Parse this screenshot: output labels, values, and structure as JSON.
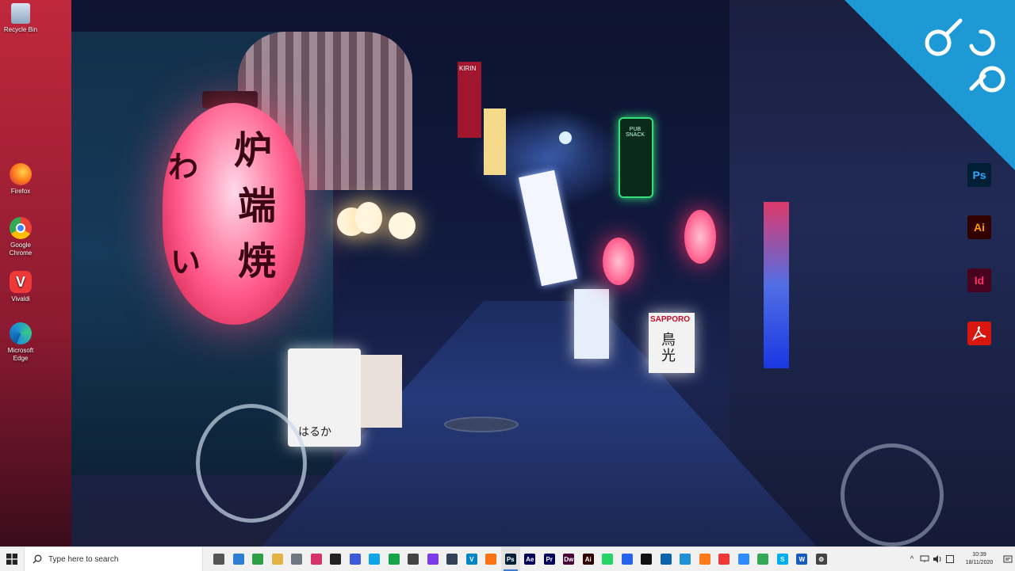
{
  "desktop": {
    "icons": [
      {
        "label": "Recycle Bin",
        "icon": "recycle-bin-icon"
      },
      {
        "label": "Firefox",
        "icon": "firefox-icon",
        "color": "#ff7a1a"
      },
      {
        "label": "Google Chrome",
        "icon": "chrome-icon",
        "color": "#34a853"
      },
      {
        "label": "Vivaldi",
        "icon": "vivaldi-icon",
        "color": "#ef3939"
      },
      {
        "label": "Microsoft Edge",
        "icon": "edge-icon",
        "color": "#1f8fd6"
      }
    ],
    "side_apps": [
      {
        "label": "Ps",
        "icon": "photoshop-icon",
        "bg": "#001e36",
        "fg": "#31a8ff"
      },
      {
        "label": "Ai",
        "icon": "illustrator-icon",
        "bg": "#330000",
        "fg": "#ff9a00"
      },
      {
        "label": "Id",
        "icon": "indesign-icon",
        "bg": "#49021f",
        "fg": "#ff3366"
      },
      {
        "label": "",
        "icon": "acrobat-icon",
        "bg": "#d8180f",
        "fg": "#ffffff"
      }
    ]
  },
  "wallpaper": {
    "description_icon": "neon-alley-wallpaper",
    "lantern_glyphs": [
      "炉",
      "端",
      "焼"
    ],
    "lantern_side_glyphs": [
      "わ",
      "い"
    ],
    "signs": {
      "pub_snack": "PUB SNACK",
      "sapporo": "SAPPORO",
      "sapporo_sub": "鳥光",
      "haruka": "はるか",
      "kirin": "KIRIN"
    }
  },
  "corner_logo": {
    "icon": "dcp-logo",
    "color": "#1d9ad6"
  },
  "taskbar": {
    "search_placeholder": "Type here to search",
    "apps": [
      {
        "icon": "task-view-icon",
        "glyph": "",
        "color": "#555555"
      },
      {
        "icon": "snip-icon",
        "glyph": "",
        "color": "#2d7dd2"
      },
      {
        "icon": "xbox-icon",
        "glyph": "",
        "color": "#2ea043"
      },
      {
        "icon": "explorer-icon",
        "glyph": "",
        "color": "#e3b341"
      },
      {
        "icon": "calculator-icon",
        "glyph": "",
        "color": "#6e7781"
      },
      {
        "icon": "paint-icon",
        "glyph": "",
        "color": "#d6336c"
      },
      {
        "icon": "obs-icon",
        "glyph": "",
        "color": "#222222"
      },
      {
        "icon": "save-icon",
        "glyph": "",
        "color": "#3b5bdb"
      },
      {
        "icon": "notes-icon",
        "glyph": "",
        "color": "#0ea5e9"
      },
      {
        "icon": "edit-icon",
        "glyph": "",
        "color": "#16a34a"
      },
      {
        "icon": "inkscape-icon",
        "glyph": "",
        "color": "#444444"
      },
      {
        "icon": "pen-icon",
        "glyph": "",
        "color": "#7c3aed"
      },
      {
        "icon": "resolve-icon",
        "glyph": "",
        "color": "#334155"
      },
      {
        "icon": "vectorworks-icon",
        "glyph": "V",
        "color": "#0284c7"
      },
      {
        "icon": "blender-icon",
        "glyph": "",
        "color": "#f97316"
      },
      {
        "icon": "photoshop-icon",
        "glyph": "Ps",
        "color": "#001e36",
        "active": true
      },
      {
        "icon": "aftereffects-icon",
        "glyph": "Ae",
        "color": "#00005b"
      },
      {
        "icon": "premiere-icon",
        "glyph": "Pr",
        "color": "#00005b"
      },
      {
        "icon": "dreamweaver-icon",
        "glyph": "Dw",
        "color": "#470137"
      },
      {
        "icon": "illustrator-icon",
        "glyph": "Ai",
        "color": "#330000"
      },
      {
        "icon": "whatsapp-icon",
        "glyph": "",
        "color": "#25d366"
      },
      {
        "icon": "mail-icon",
        "glyph": "",
        "color": "#2563eb"
      },
      {
        "icon": "github-icon",
        "glyph": "",
        "color": "#111111"
      },
      {
        "icon": "outlook-icon",
        "glyph": "",
        "color": "#0a64ad"
      },
      {
        "icon": "edge-icon",
        "glyph": "",
        "color": "#1f8fd6"
      },
      {
        "icon": "firefox-icon",
        "glyph": "",
        "color": "#ff7a1a"
      },
      {
        "icon": "vivaldi-icon",
        "glyph": "",
        "color": "#ef3939"
      },
      {
        "icon": "zoom-icon",
        "glyph": "",
        "color": "#2d8cff"
      },
      {
        "icon": "chrome-icon",
        "glyph": "",
        "color": "#34a853"
      },
      {
        "icon": "skype-icon",
        "glyph": "S",
        "color": "#00aff0"
      },
      {
        "icon": "word-icon",
        "glyph": "W",
        "color": "#185abd"
      },
      {
        "icon": "settings-icon",
        "glyph": "⚙",
        "color": "#444444"
      }
    ],
    "tray": {
      "chevron": "^",
      "clock_time": "10:39",
      "clock_date": "18/11/2020"
    }
  }
}
